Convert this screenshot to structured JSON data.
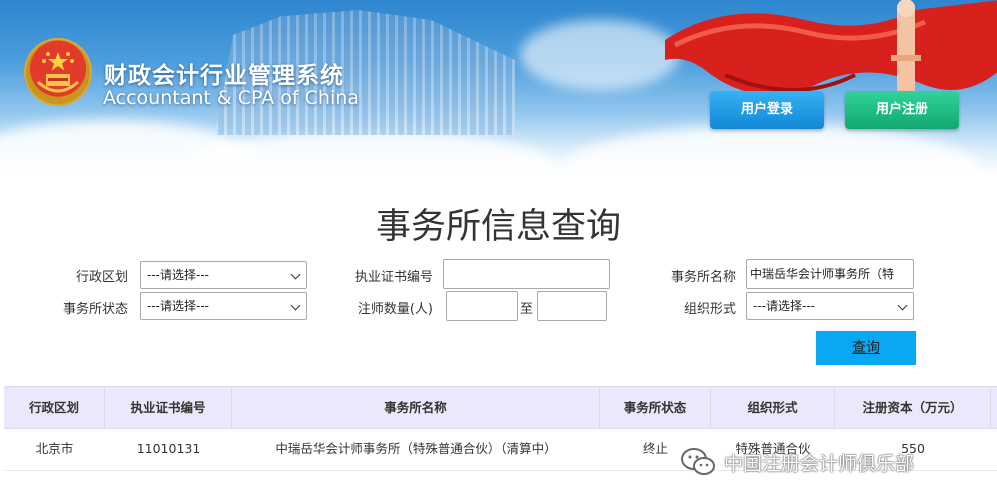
{
  "header": {
    "title_cn": "财政会计行业管理系统",
    "title_en": "Accountant & CPA of China",
    "login_label": "用户登录",
    "register_label": "用户注册"
  },
  "page": {
    "title": "事务所信息查询"
  },
  "form": {
    "region": {
      "label": "行政区划",
      "value": "---请选择---"
    },
    "license_no": {
      "label": "执业证书编号",
      "value": ""
    },
    "firm_name": {
      "label": "事务所名称",
      "value": "中瑞岳华会计师事务所（特"
    },
    "status": {
      "label": "事务所状态",
      "value": "---请选择---"
    },
    "cpa_count": {
      "label": "注师数量(人)",
      "from": "",
      "to_label": "至",
      "to": ""
    },
    "org_form": {
      "label": "组织形式",
      "value": "---请选择---"
    },
    "query_label": "查询"
  },
  "table": {
    "headers": [
      "行政区划",
      "执业证书编号",
      "事务所名称",
      "事务所状态",
      "组织形式",
      "注册资本（万元）"
    ],
    "rows": [
      [
        "北京市",
        "11010131",
        "中瑞岳华会计师事务所（特殊普通合伙）（清算中）",
        "终止",
        "特殊普通合伙",
        "550"
      ]
    ]
  },
  "watermark": {
    "text": "中国注册会计师俱乐部"
  },
  "colors": {
    "login_button": "#1a93e0",
    "register_button": "#17b57c",
    "query_button": "#08a8f2",
    "table_header_bg": "#eae8fb"
  },
  "icons": [
    "national-emblem-icon",
    "flag-ribbon-graphic",
    "wechat-icon"
  ]
}
